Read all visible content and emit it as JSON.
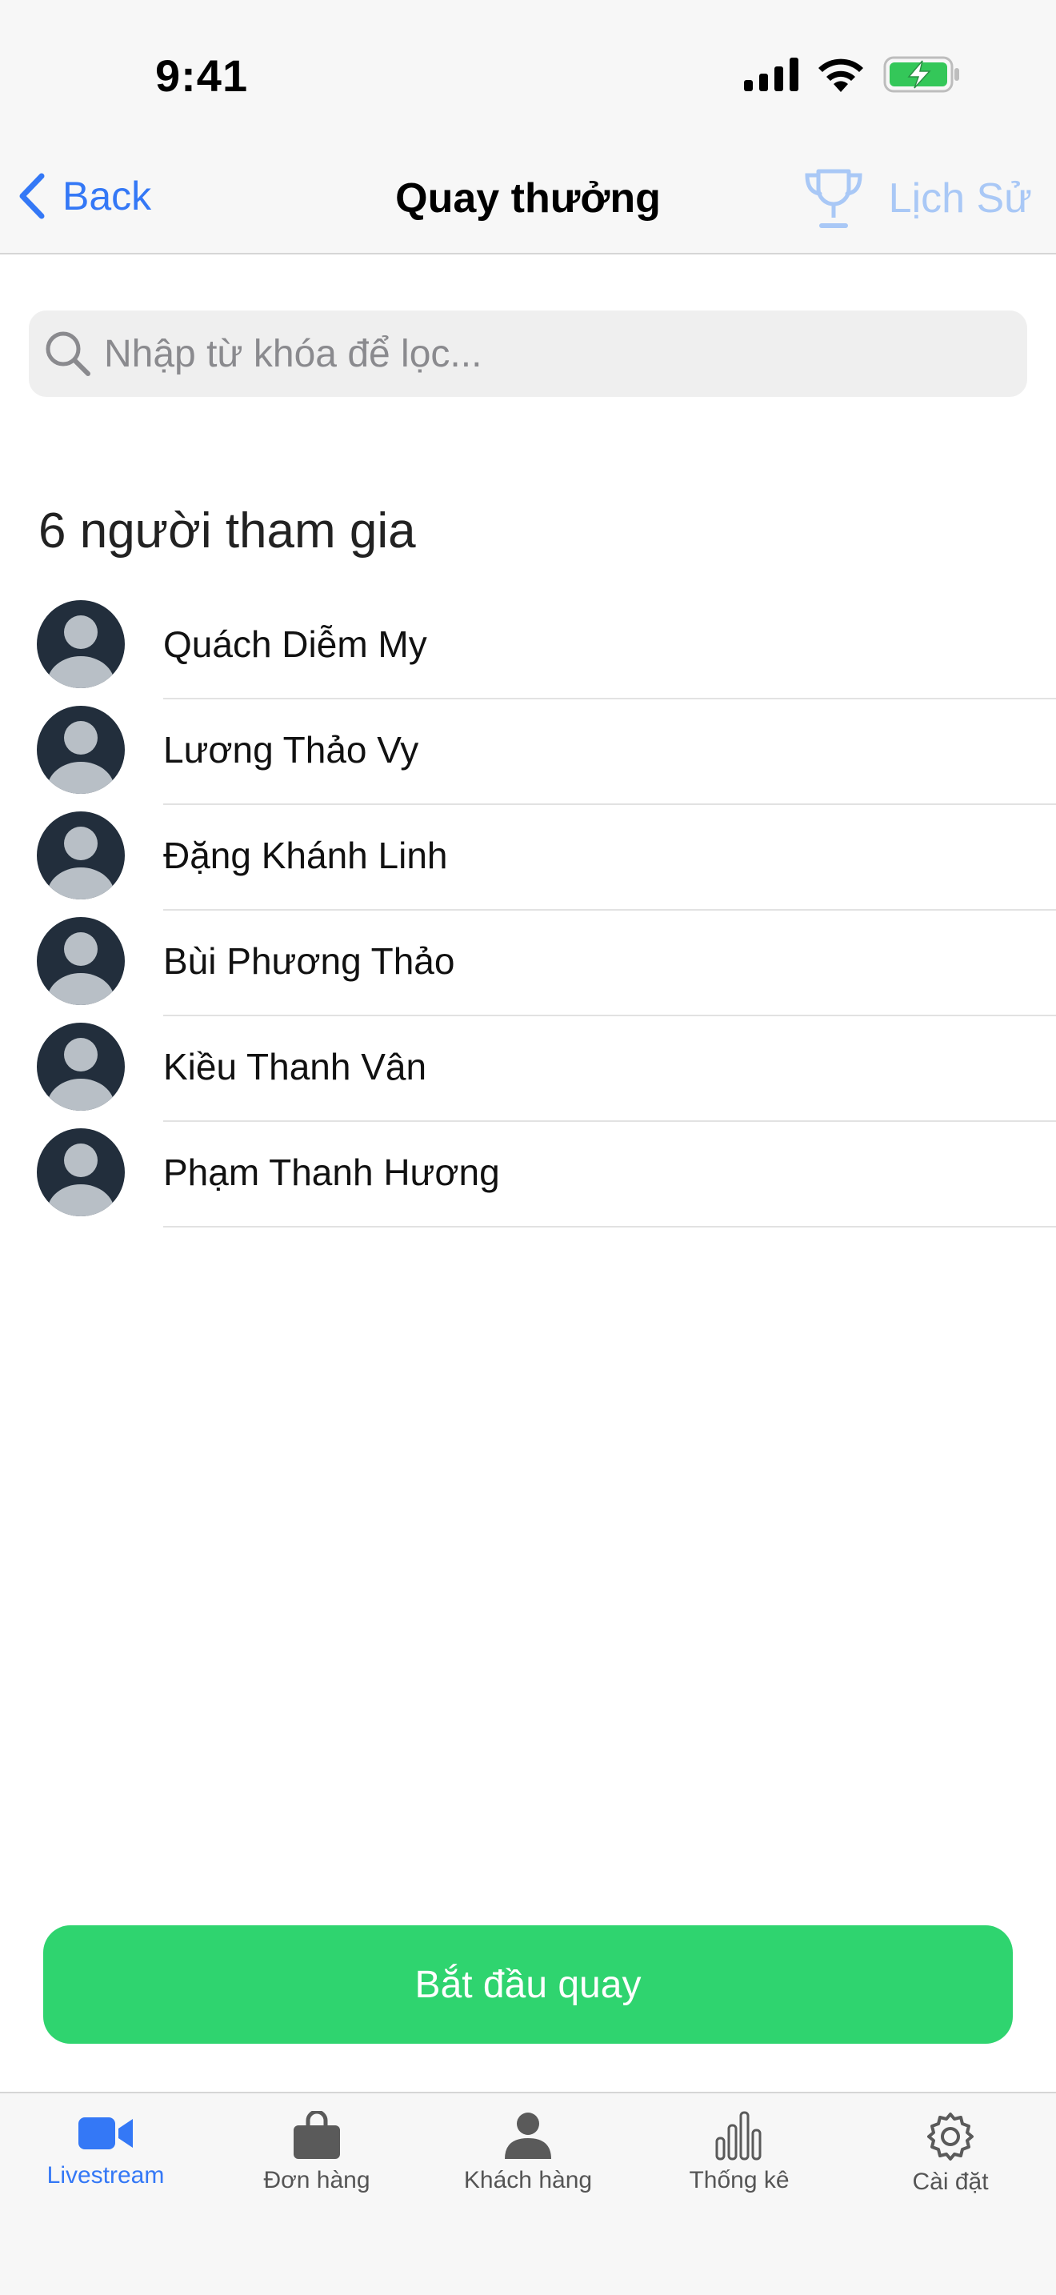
{
  "status_bar": {
    "time": "9:41"
  },
  "nav": {
    "back_label": "Back",
    "title": "Quay thưởng",
    "history_label": "Lịch Sử"
  },
  "search": {
    "placeholder": "Nhập từ khóa để lọc..."
  },
  "participants": {
    "count_label": "6 người tham gia",
    "items": [
      {
        "name": "Quách Diễm My"
      },
      {
        "name": "Lương Thảo Vy"
      },
      {
        "name": "Đặng Khánh Linh"
      },
      {
        "name": "Bùi Phương Thảo"
      },
      {
        "name": "Kiều Thanh Vân"
      },
      {
        "name": "Phạm Thanh Hương"
      }
    ]
  },
  "action": {
    "start_label": "Bắt đầu quay"
  },
  "tabbar": {
    "items": [
      {
        "label": "Livestream",
        "icon": "video-camera-icon",
        "active": true
      },
      {
        "label": "Đơn hàng",
        "icon": "shopping-bag-icon",
        "active": false
      },
      {
        "label": "Khách hàng",
        "icon": "person-icon",
        "active": false
      },
      {
        "label": "Thống kê",
        "icon": "bar-chart-icon",
        "active": false
      },
      {
        "label": "Cài đặt",
        "icon": "gear-icon",
        "active": false
      }
    ]
  },
  "colors": {
    "accent": "#3478f6",
    "start_button": "#2fd46f",
    "history_disabled": "#a9c8f6",
    "battery_fill": "#34c759"
  }
}
